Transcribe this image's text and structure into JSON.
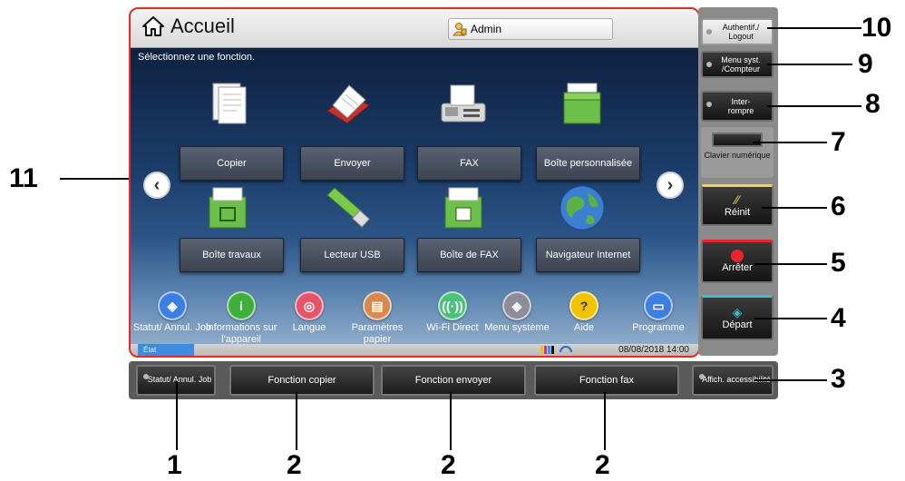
{
  "header": {
    "title": "Accueil",
    "user": "Admin"
  },
  "prompt": "Sélectionnez une fonction.",
  "functions": [
    {
      "label": "Copier",
      "icon": "copier-icon"
    },
    {
      "label": "Envoyer",
      "icon": "send-icon"
    },
    {
      "label": "FAX",
      "icon": "fax-icon"
    },
    {
      "label": "Boîte personnalisée",
      "icon": "custom-box-icon"
    },
    {
      "label": "Boîte travaux",
      "icon": "job-box-icon"
    },
    {
      "label": "Lecteur USB",
      "icon": "usb-drive-icon"
    },
    {
      "label": "Boîte de FAX",
      "icon": "fax-box-icon"
    },
    {
      "label": "Navigateur Internet",
      "icon": "globe-icon"
    }
  ],
  "shortcuts": [
    {
      "label": "Statut/ Annul. Job",
      "color": "#3b7fe0"
    },
    {
      "label": "Informations sur l'appareil",
      "color": "#3fae3a"
    },
    {
      "label": "Langue",
      "color": "#e6546a"
    },
    {
      "label": "Paramètres papier",
      "color": "#d48a52"
    },
    {
      "label": "Wi-Fi Direct",
      "color": "#4cc07a"
    },
    {
      "label": "Menu système",
      "color": "#8c8c9a"
    },
    {
      "label": "Aide",
      "color": "#f2c200"
    },
    {
      "label": "Programme",
      "color": "#3b7fe0"
    }
  ],
  "status": {
    "tab": "État",
    "datetime": "08/08/2018 14:00"
  },
  "bottom_buttons": [
    "Statut/ Annul. Job",
    "Fonction copier",
    "Fonction envoyer",
    "Fonction fax",
    "Affich. accessibilité"
  ],
  "right_buttons": {
    "auth": "Authentif./ Logout",
    "menu": "Menu syst. /Compteur",
    "interrupt": "Inter- rompre",
    "keypad": "Clavier numérique",
    "reset": "Réinit",
    "stop": "Arrêter",
    "start": "Départ"
  },
  "callouts": [
    "1",
    "2",
    "2",
    "2",
    "3",
    "4",
    "5",
    "6",
    "7",
    "8",
    "9",
    "10",
    "11"
  ],
  "colors": {
    "frame": "#e8262a",
    "reset_accent": "#e8d84a",
    "stop_accent": "#e8262a",
    "start_accent": "#3fbfbf"
  }
}
